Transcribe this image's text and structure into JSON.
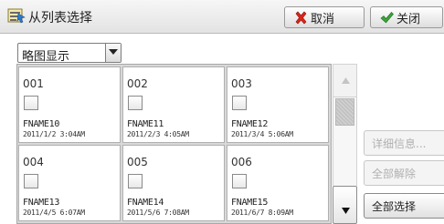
{
  "header": {
    "title": "从列表选择",
    "cancel_label": "取消",
    "close_label": "关闭",
    "icons": {
      "title": "list-select-icon",
      "cancel": "red-x-icon",
      "close": "green-check-icon"
    }
  },
  "view_dropdown": {
    "selected": "略图显示"
  },
  "files": [
    {
      "num": "001",
      "name": "FNAME10",
      "date": "2011/1/2 3:04AM"
    },
    {
      "num": "002",
      "name": "FNAME11",
      "date": "2011/2/3 4:05AM"
    },
    {
      "num": "003",
      "name": "FNAME12",
      "date": "2011/3/4 5:06AM"
    },
    {
      "num": "004",
      "name": "FNAME13",
      "date": "2011/4/5 6:07AM"
    },
    {
      "num": "005",
      "name": "FNAME14",
      "date": "2011/5/6 7:08AM"
    },
    {
      "num": "006",
      "name": "FNAME15",
      "date": "2011/6/7 8:09AM"
    }
  ],
  "side_buttons": {
    "details_label": "详细信息...",
    "clear_all_label": "全部解除",
    "select_all_label": "全部选择"
  },
  "colors": {
    "cancel_icon": "#d9261c",
    "close_icon": "#3aa43a",
    "disabled_text": "#b0b0b0"
  }
}
